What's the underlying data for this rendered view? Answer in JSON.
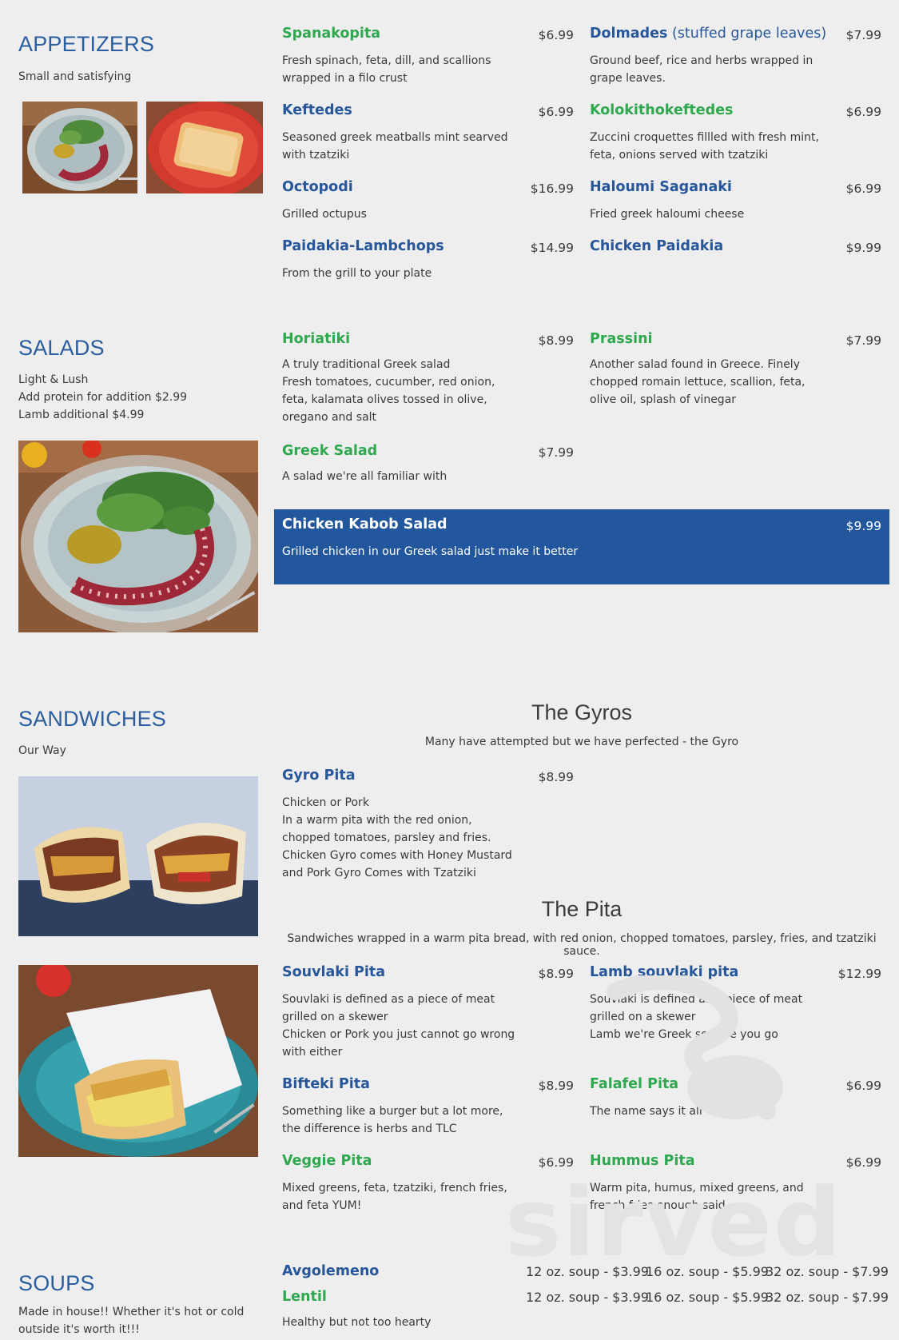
{
  "appetizers": {
    "title": "APPETIZERS",
    "subtitle": "Small and satisfying",
    "items": [
      {
        "name": "Spanakopita",
        "price": "$6.99",
        "desc": "Fresh spinach, feta, dill, and scallions wrapped in a filo crust"
      },
      {
        "name": "Dolmades",
        "name_suffix": " (stuffed grape leaves)",
        "price": "$7.99",
        "desc": "Ground beef, rice and herbs wrapped in grape leaves."
      },
      {
        "name": "Keftedes",
        "price": "$6.99",
        "desc": "Seasoned greek meatballs mint searved with tzatziki"
      },
      {
        "name": "Kolokithokeftedes",
        "price": "$6.99",
        "desc": "Zuccini croquettes fillled with fresh mint, feta, onions served with tzatziki"
      },
      {
        "name": "Octopodi",
        "price": "$16.99",
        "desc": "Grilled octupus"
      },
      {
        "name": "Haloumi Saganaki",
        "price": "$6.99",
        "desc": "Fried greek haloumi cheese"
      },
      {
        "name": "Paidakia-Lambchops",
        "price": "$14.99",
        "desc": "From the grill to your plate"
      },
      {
        "name": "Chicken Paidakia",
        "price": "$9.99"
      }
    ]
  },
  "salads": {
    "title": "SALADS",
    "subtitle_lines": [
      "Light & Lush",
      "Add protein for addition $2.99",
      "Lamb additional $4.99"
    ],
    "items": [
      {
        "name": "Horiatiki",
        "price": "$8.99",
        "desc_lines": [
          "A truly traditional Greek salad",
          "Fresh tomatoes, cucumber, red onion, feta, kalamata olives tossed in olive, oregano and salt"
        ]
      },
      {
        "name": "Prassini",
        "price": "$7.99",
        "desc": "Another salad found in Greece. Finely chopped romain lettuce, scallion, feta, olive oil, splash of vinegar"
      },
      {
        "name": "Greek Salad",
        "price": "$7.99",
        "desc": "A salad we're all familiar with"
      },
      {
        "name": "Chicken Kabob Salad",
        "price": "$9.99",
        "desc": "Grilled chicken in our Greek salad just make it better"
      }
    ]
  },
  "sandwiches": {
    "title": "SANDWICHES",
    "subtitle": "Our Way",
    "gyros": {
      "title": "The Gyros",
      "subtitle": "Many have attempted but we have perfected - the Gyro",
      "item": {
        "name": "Gyro Pita",
        "price": "$8.99",
        "desc_lines": [
          "Chicken or Pork",
          "In a warm pita with the red onion, chopped tomatoes, parsley and fries. Chicken Gyro comes with Honey Mustard and Pork Gyro Comes with Tzatziki"
        ]
      }
    },
    "pita": {
      "title": "The Pita",
      "subtitle": "Sandwiches wrapped in a warm pita bread, with red onion, chopped tomatoes, parsley, fries, and tzatziki sauce.",
      "items": [
        {
          "name": "Souvlaki Pita",
          "price": "$8.99",
          "desc_lines": [
            "Souvlaki is defined as a piece of meat grilled on a skewer",
            "Chicken or Pork you just cannot go wrong with either"
          ]
        },
        {
          "name": "Lamb souvlaki pita",
          "price": "$12.99",
          "desc_lines": [
            "Souvlaki is defined as a piece of meat grilled on a skewer",
            "Lamb we're Greek so here you go"
          ]
        },
        {
          "name": "Bifteki Pita",
          "price": "$8.99",
          "desc": "Something like a burger but a lot more, the difference is herbs and TLC"
        },
        {
          "name": "Falafel Pita",
          "price": "$6.99",
          "desc": "The name says it all"
        },
        {
          "name": "Veggie Pita",
          "price": "$6.99",
          "desc": "Mixed greens, feta, tzatziki, french fries, and feta YUM!"
        },
        {
          "name": "Hummus Pita",
          "price": "$6.99",
          "desc": "Warm pita, humus, mixed greens, and french fries enough said"
        }
      ]
    }
  },
  "soups": {
    "title": "SOUPS",
    "subtitle": "Made in house!! Whether it's hot or cold outside it's worth it!!!",
    "items": [
      {
        "name": "Avgolemeno",
        "prices": [
          "12 oz. soup - $3.99",
          "16 oz. soup - $5.99",
          "32 oz. soup - $7.99"
        ]
      },
      {
        "name": "Lentil",
        "prices": [
          "12 oz. soup - $3.99",
          "16 oz. soup - $5.99",
          "32 oz. soup - $7.99"
        ],
        "desc": "Healthy but not too hearty"
      }
    ]
  },
  "watermark": "sirved",
  "colors": {
    "section_title": "#2a5ea0",
    "item_blue": "#27579a",
    "item_green": "#2fa84f",
    "banner": "#23579d",
    "background": "#eeeeee"
  }
}
